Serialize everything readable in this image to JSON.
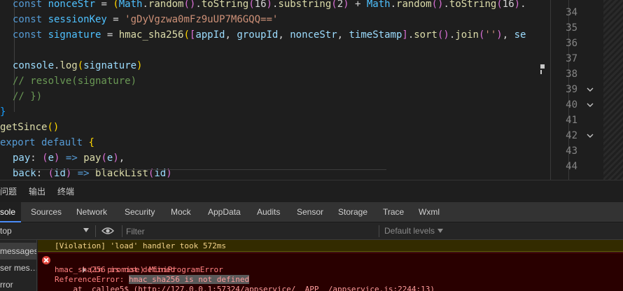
{
  "editor": {
    "lines": [
      {
        "tokens": [
          [
            "kw",
            "const "
          ],
          [
            "var",
            "nonceStr"
          ],
          [
            "op",
            " = "
          ],
          [
            "br1",
            "("
          ],
          [
            "var",
            "Math"
          ],
          [
            "op",
            "."
          ],
          [
            "fn",
            "random"
          ],
          [
            "br2",
            "()"
          ],
          [
            "op",
            "."
          ],
          [
            "fn",
            "toString"
          ],
          [
            "br2",
            "("
          ],
          [
            "op",
            "16"
          ],
          [
            "br2",
            ")"
          ],
          [
            "op",
            "."
          ],
          [
            "fn",
            "substring"
          ],
          [
            "br2",
            "("
          ],
          [
            "op",
            "2"
          ],
          [
            "br2",
            ")"
          ],
          [
            "op",
            " + "
          ],
          [
            "var",
            "Math"
          ],
          [
            "op",
            "."
          ],
          [
            "fn",
            "random"
          ],
          [
            "br2",
            "()"
          ],
          [
            "op",
            "."
          ],
          [
            "fn",
            "toString"
          ],
          [
            "br2",
            "("
          ],
          [
            "op",
            "16"
          ],
          [
            "br2",
            ")"
          ],
          [
            "op",
            "."
          ]
        ]
      },
      {
        "tokens": [
          [
            "kw",
            "const "
          ],
          [
            "var",
            "sessionKey"
          ],
          [
            "op",
            " = "
          ],
          [
            "str",
            "'gDyVgzwa0mFz9uUP7M6GQQ=='"
          ]
        ]
      },
      {
        "tokens": [
          [
            "kw",
            "const "
          ],
          [
            "var",
            "signature"
          ],
          [
            "op",
            " = "
          ],
          [
            "fn",
            "hmac_sha256"
          ],
          [
            "br1",
            "("
          ],
          [
            "br2",
            "["
          ],
          [
            "pl",
            "appId"
          ],
          [
            "op",
            ", "
          ],
          [
            "pl",
            "groupId"
          ],
          [
            "op",
            ", "
          ],
          [
            "pl",
            "nonceStr"
          ],
          [
            "op",
            ", "
          ],
          [
            "pl",
            "timeStamp"
          ],
          [
            "br2",
            "]"
          ],
          [
            "op",
            "."
          ],
          [
            "fn",
            "sort"
          ],
          [
            "br2",
            "()"
          ],
          [
            "op",
            "."
          ],
          [
            "fn",
            "join"
          ],
          [
            "br2",
            "("
          ],
          [
            "str",
            "''"
          ],
          [
            "br2",
            ")"
          ],
          [
            "op",
            ", "
          ],
          [
            "pl",
            "se"
          ]
        ]
      },
      {
        "tokens": []
      },
      {
        "tokens": [
          [
            "pl",
            "console"
          ],
          [
            "op",
            "."
          ],
          [
            "fn",
            "log"
          ],
          [
            "br1",
            "("
          ],
          [
            "pl",
            "signature"
          ],
          [
            "br1",
            ")"
          ]
        ]
      },
      {
        "tokens": [
          [
            "cm",
            "// resolve(signature)"
          ]
        ]
      },
      {
        "tokens": [
          [
            "cm",
            "// })"
          ]
        ]
      },
      {
        "tokens": [
          [
            "br3",
            "}"
          ]
        ]
      },
      {
        "tokens": [
          [
            "fn",
            "getSince"
          ],
          [
            "br1",
            "()"
          ]
        ]
      },
      {
        "tokens": [
          [
            "kw",
            "export default "
          ],
          [
            "br1",
            "{"
          ]
        ]
      },
      {
        "tokens": [
          [
            "pl",
            "pay"
          ],
          [
            "op",
            ": "
          ],
          [
            "br2",
            "("
          ],
          [
            "pl",
            "e"
          ],
          [
            "br2",
            ")"
          ],
          [
            "kw",
            " => "
          ],
          [
            "fn",
            "pay"
          ],
          [
            "br2",
            "("
          ],
          [
            "pl",
            "e"
          ],
          [
            "br2",
            ")"
          ],
          [
            "op",
            ","
          ]
        ]
      },
      {
        "tokens": [
          [
            "pl",
            "back"
          ],
          [
            "op",
            ": "
          ],
          [
            "br2",
            "("
          ],
          [
            "pl",
            "id"
          ],
          [
            "br2",
            ")"
          ],
          [
            "kw",
            " => "
          ],
          [
            "fn",
            "blackList"
          ],
          [
            "br2",
            "("
          ],
          [
            "pl",
            "id"
          ],
          [
            "br2",
            ")"
          ]
        ]
      }
    ],
    "line_numbers": [
      "34",
      "35",
      "36",
      "37",
      "38",
      "39",
      "40",
      "41",
      "42",
      "43",
      "44"
    ]
  },
  "bottom_tabs": [
    "问题",
    "输出",
    "终端"
  ],
  "devtools": {
    "tabs": [
      "sole",
      "Sources",
      "Network",
      "Security",
      "Mock",
      "AppData",
      "Audits",
      "Sensor",
      "Storage",
      "Trace",
      "Wxml"
    ],
    "context": "top",
    "filter_placeholder": "Filter",
    "levels": "Default levels",
    "sidebar": [
      "messages",
      "ser mes…",
      "rror"
    ],
    "warn": "[Violation] 'load' handler took 572ms",
    "error_lines": {
      "head": "(in promise) MiniProgramError",
      "msg": "hmac_sha256 is not defined",
      "ref_prefix": "ReferenceError: ",
      "ref_hl": "hmac_sha256 is not defined",
      "stack": "    at _callee5$ (http://127.0.0.1:57324/appservice/__APP__/appservice.js:2244:13)"
    }
  },
  "colors": {
    "accent": "#4a8cf7",
    "error": "#ff8080",
    "warn": "#f2d28a"
  }
}
